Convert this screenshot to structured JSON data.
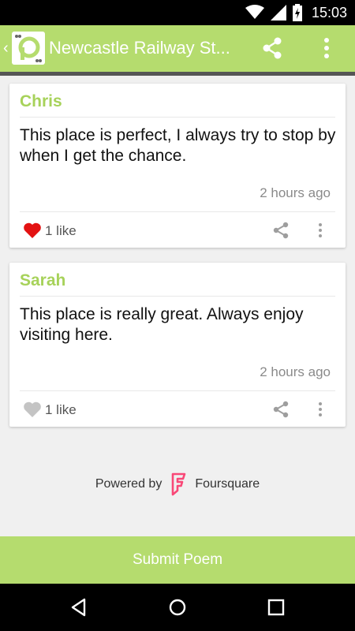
{
  "status_bar": {
    "time": "15:03"
  },
  "app_bar": {
    "title": "Newcastle Railway St...",
    "accent_color": "#b5dc6e"
  },
  "reviews": [
    {
      "author": "Chris",
      "text": "This place is perfect, I always try to stop by when I get the chance.",
      "time": "2 hours ago",
      "likes": "1 like",
      "liked": true
    },
    {
      "author": "Sarah",
      "text": "This place is really great. Always enjoy visiting here.",
      "time": "2 hours ago",
      "likes": "1 like",
      "liked": false
    }
  ],
  "footer": {
    "powered_by": "Powered by",
    "brand": "Foursquare",
    "brand_color": "#f94877"
  },
  "submit": {
    "label": "Submit Poem"
  },
  "icons": {
    "status": [
      "wifi-icon",
      "signal-icon",
      "battery-icon"
    ],
    "app_bar": [
      "back-chevron-icon",
      "app-logo-icon",
      "share-icon",
      "overflow-menu-icon"
    ],
    "card": [
      "heart-icon",
      "share-icon",
      "overflow-menu-icon"
    ],
    "nav": [
      "nav-back-icon",
      "nav-home-icon",
      "nav-recent-icon"
    ]
  }
}
